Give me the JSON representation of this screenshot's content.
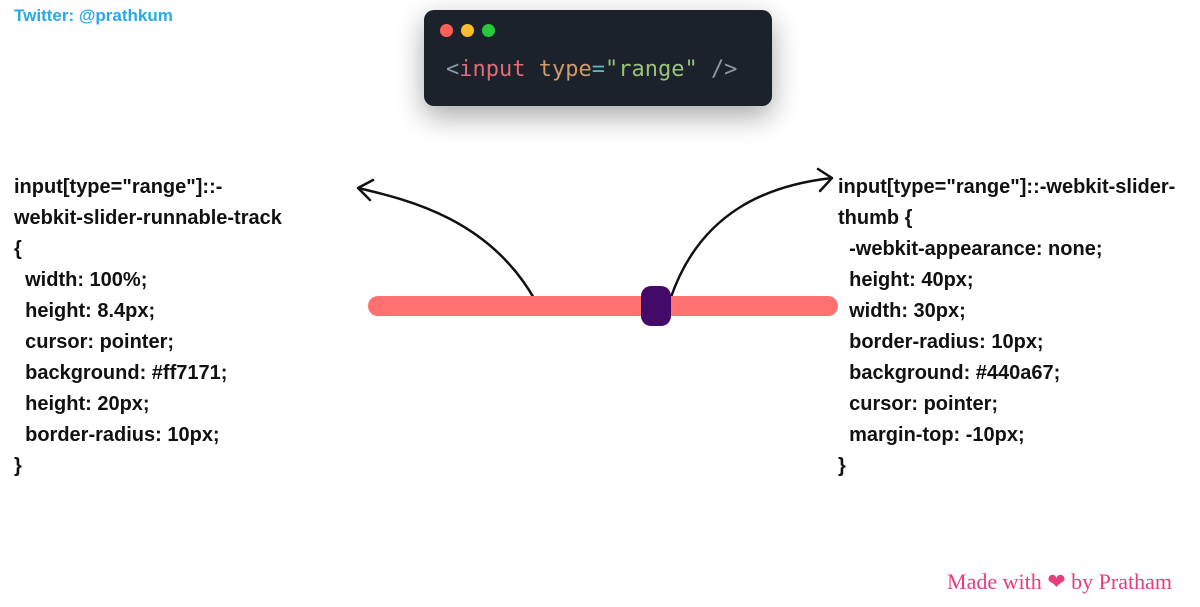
{
  "twitter_handle": "Twitter: @prathkum",
  "code_window": {
    "tag": "input",
    "attr": "type",
    "value": "\"range\""
  },
  "track_css": "input[type=\"range\"]::-\nwebkit-slider-runnable-track\n{\n  width: 100%;\n  height: 8.4px;\n  cursor: pointer;\n  background: #ff7171;\n  height: 20px;\n  border-radius: 10px;\n}",
  "thumb_css": "input[type=\"range\"]::-webkit-slider-\nthumb {\n  -webkit-appearance: none;\n  height: 40px;\n  width: 30px;\n  border-radius: 10px;\n  background: #440a67;\n  cursor: pointer;\n  margin-top: -10px;\n}",
  "slider": {
    "value": 62,
    "track_color": "#ff7171",
    "thumb_color": "#440a67"
  },
  "footer": {
    "prefix": "Made with ",
    "heart": "❤",
    "suffix": " by Pratham"
  }
}
